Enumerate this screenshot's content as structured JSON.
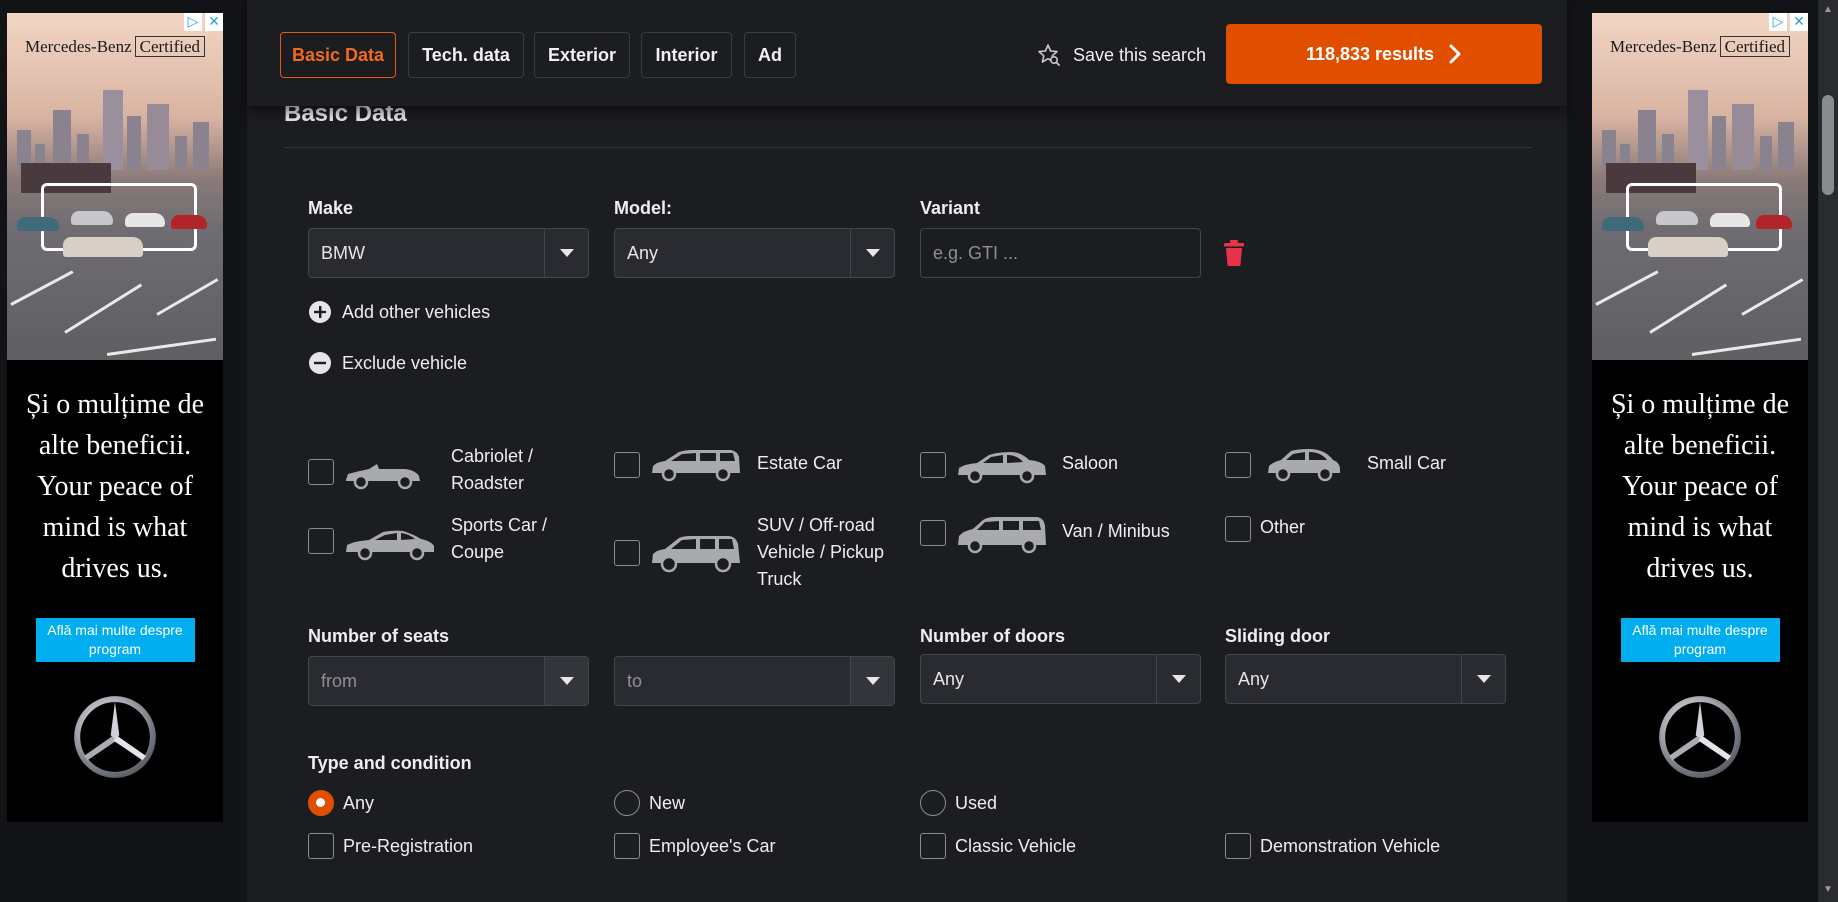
{
  "ad": {
    "brand": "Mercedes-Benz",
    "brand_tag": "Certified",
    "headline": "Și o mulțime de alte beneficii. Your peace of mind is what drives us.",
    "cta": "Află mai multe despre program"
  },
  "tabs": [
    {
      "label": "Basic Data",
      "active": true
    },
    {
      "label": "Tech. data",
      "active": false
    },
    {
      "label": "Exterior",
      "active": false
    },
    {
      "label": "Interior",
      "active": false
    },
    {
      "label": "Ad",
      "active": false
    }
  ],
  "header": {
    "save_search": "Save this search",
    "results": "118,833 results"
  },
  "section_title": "Basic Data",
  "vehicle": {
    "make_label": "Make",
    "make_value": "BMW",
    "model_label": "Model:",
    "model_value": "Any",
    "variant_label": "Variant",
    "variant_placeholder": "e.g. GTI ..."
  },
  "actions": {
    "add_other": "Add other vehicles",
    "exclude": "Exclude vehicle"
  },
  "body_types": [
    {
      "label": "Cabriolet / Roadster",
      "lines": [
        "Cabriolet /",
        "Roadster"
      ],
      "icon": "cabriolet-icon"
    },
    {
      "label": "Estate Car",
      "lines": [
        "Estate Car"
      ],
      "icon": "estate-car-icon"
    },
    {
      "label": "Saloon",
      "lines": [
        "Saloon"
      ],
      "icon": "saloon-icon"
    },
    {
      "label": "Small Car",
      "lines": [
        "Small Car"
      ],
      "icon": "small-car-icon"
    },
    {
      "label": "Sports Car / Coupe",
      "lines": [
        "Sports Car /",
        "Coupe"
      ],
      "icon": "sports-car-icon"
    },
    {
      "label": "SUV / Off-road Vehicle / Pickup Truck",
      "lines": [
        "SUV / Off-road",
        "Vehicle / Pickup",
        "Truck"
      ],
      "icon": "suv-icon"
    },
    {
      "label": "Van / Minibus",
      "lines": [
        "Van / Minibus"
      ],
      "icon": "van-icon"
    },
    {
      "label": "Other",
      "lines": [
        "Other"
      ],
      "icon": ""
    }
  ],
  "seats": {
    "label": "Number of seats",
    "from_placeholder": "from",
    "to_placeholder": "to"
  },
  "doors": {
    "label": "Number of doors",
    "value": "Any"
  },
  "sliding_door": {
    "label": "Sliding door",
    "value": "Any"
  },
  "condition": {
    "label": "Type and condition",
    "radios": [
      {
        "label": "Any",
        "checked": true
      },
      {
        "label": "New",
        "checked": false
      },
      {
        "label": "Used",
        "checked": false
      }
    ],
    "checkboxes": [
      "Pre-Registration",
      "Employee's Car",
      "Classic Vehicle",
      "Demonstration Vehicle"
    ]
  },
  "colors": {
    "accent": "#e04f00",
    "delete": "#e8334a",
    "ad_cta": "#00adef"
  }
}
